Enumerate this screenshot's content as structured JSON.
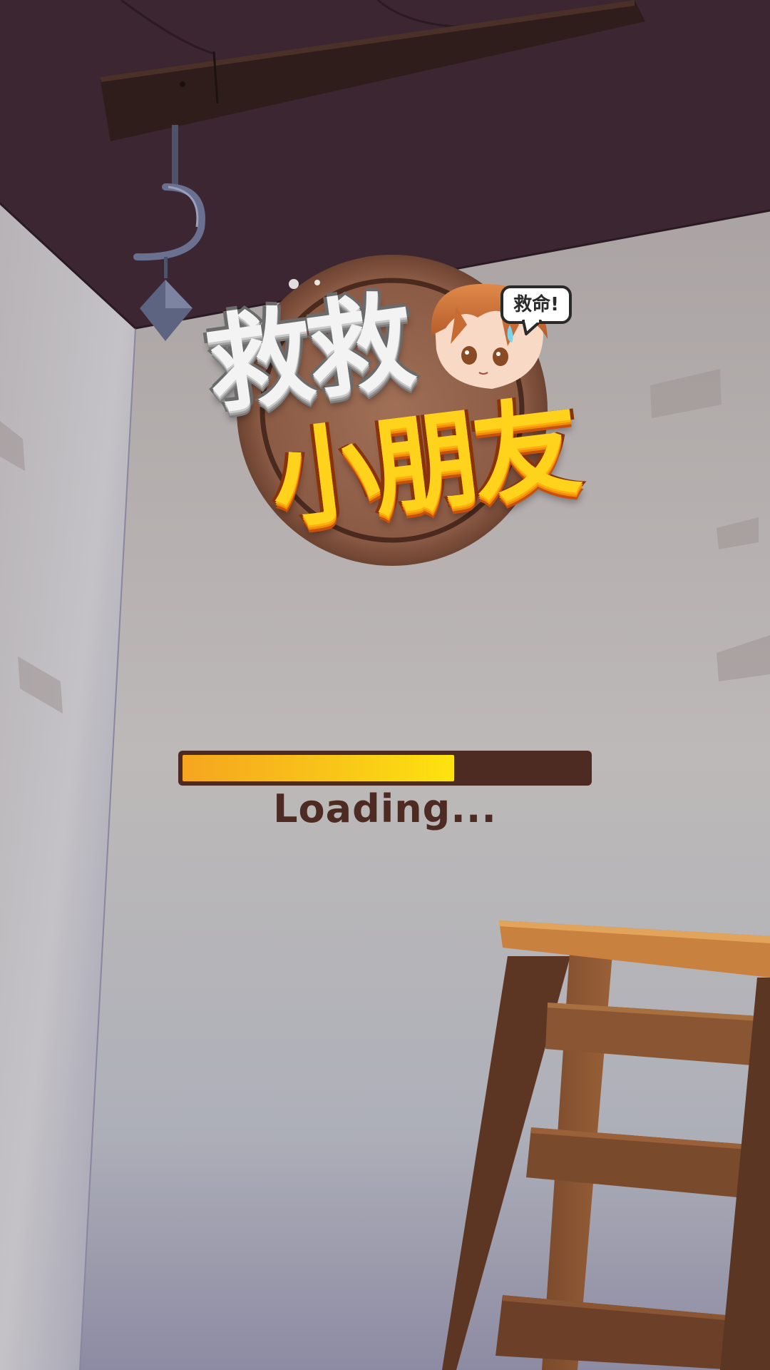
{
  "game": {
    "title_line1": "救救",
    "title_line2": "小朋友",
    "speech_bubble": "救命!"
  },
  "loader": {
    "label": "Loading...",
    "progress": 0.67
  },
  "colors": {
    "ceiling": "#3c2631",
    "wall": "#b4adaa",
    "progress_track": "#4e2b22",
    "progress_fill_start": "#f6a51f",
    "progress_fill_end": "#fde30f",
    "loading_text": "#4e2b22",
    "title_white": "#f3f3f3",
    "title_yellow": "#ffd21c"
  },
  "icons": {
    "hook": "hook-icon",
    "ladder": "ladder-icon"
  }
}
